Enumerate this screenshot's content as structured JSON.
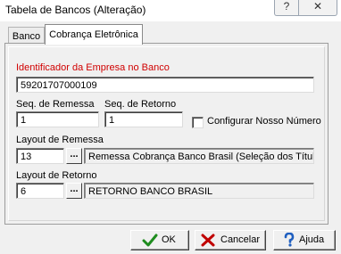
{
  "window": {
    "title": "Tabela de Bancos (Alteração)",
    "help_glyph": "?",
    "close_glyph": "✕"
  },
  "tabs": [
    {
      "label": "Banco",
      "active": false
    },
    {
      "label": "Cobrança Eletrônica",
      "active": true
    }
  ],
  "form": {
    "empresa_label": "Identificador da Empresa no Banco",
    "empresa_value": "59201707000109",
    "seq_remessa_label": "Seq. de Remessa",
    "seq_remessa_value": "1",
    "seq_retorno_label": "Seq. de Retorno",
    "seq_retorno_value": "1",
    "configurar_label": "Configurar Nosso Número",
    "configurar_checked": false,
    "layout_remessa_label": "Layout de Remessa",
    "layout_remessa_code": "13",
    "layout_remessa_desc": "Remessa Cobrança Banco Brasil (Seleção dos Títulos",
    "layout_retorno_label": "Layout de Retorno",
    "layout_retorno_code": "6",
    "layout_retorno_desc": "RETORNO BANCO BRASIL",
    "ellipsis": "..."
  },
  "buttons": {
    "ok": "OK",
    "cancel": "Cancelar",
    "help": "Ajuda"
  },
  "colors": {
    "required_label": "#d00000",
    "ok_check": "#1e8c1e",
    "cancel_x": "#c00000",
    "help_icon": "#1f5fc0"
  }
}
